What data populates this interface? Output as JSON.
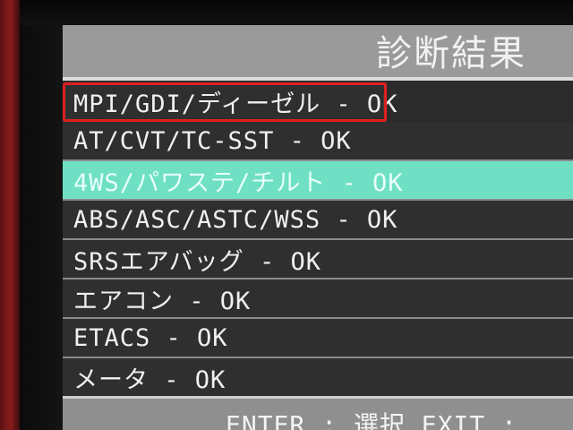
{
  "header": {
    "title": "診断結果"
  },
  "results": [
    {
      "label": "MPI/GDI/ディーゼル - OK"
    },
    {
      "label": "AT/CVT/TC-SST - OK"
    },
    {
      "label": "4WS/パワステ/チルト - OK"
    },
    {
      "label": "ABS/ASC/ASTC/WSS - OK"
    },
    {
      "label": "SRSエアバッグ - OK"
    },
    {
      "label": "エアコン - OK"
    },
    {
      "label": "ETACS - OK"
    },
    {
      "label": "メータ - OK"
    }
  ],
  "footer": {
    "hint": "ENTER : 選択   EXIT :"
  },
  "colors": {
    "highlight": "#6fe0c4",
    "annotation_frame": "#e02020",
    "header_bg": "#9a9a9a",
    "row_bg": "#2f2f2f"
  }
}
